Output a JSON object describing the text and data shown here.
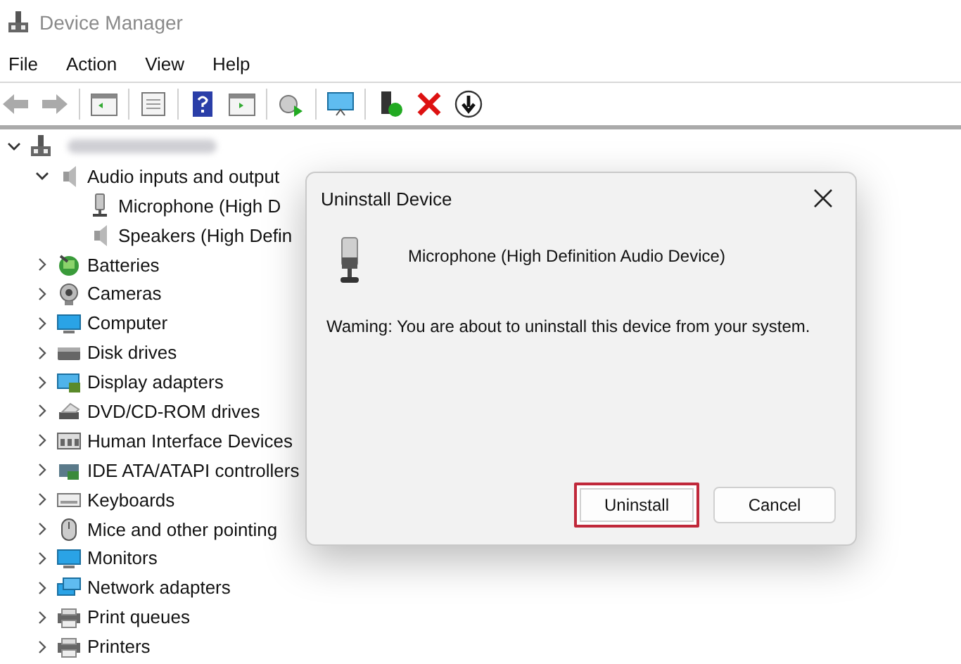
{
  "window": {
    "title": "Device Manager"
  },
  "menu": [
    "File",
    "Action",
    "View",
    "Help"
  ],
  "tree": {
    "expanded": true,
    "children": [
      {
        "label": "Audio inputs and output",
        "kind": "speaker",
        "expanded": true,
        "children": [
          {
            "label": "Microphone (High D",
            "kind": "microphone"
          },
          {
            "label": "Speakers (High Defin",
            "kind": "speaker"
          }
        ]
      },
      {
        "label": "Batteries",
        "kind": "battery",
        "expanded": false
      },
      {
        "label": "Cameras",
        "kind": "camera",
        "expanded": false
      },
      {
        "label": "Computer",
        "kind": "computer",
        "expanded": false
      },
      {
        "label": "Disk drives",
        "kind": "disk",
        "expanded": false
      },
      {
        "label": "Display adapters",
        "kind": "display",
        "expanded": false
      },
      {
        "label": "DVD/CD-ROM drives",
        "kind": "dvd",
        "expanded": false
      },
      {
        "label": "Human Interface Devices",
        "kind": "hid",
        "expanded": false
      },
      {
        "label": "IDE ATA/ATAPI controllers",
        "kind": "ide",
        "expanded": false
      },
      {
        "label": "Keyboards",
        "kind": "keyboard",
        "expanded": false
      },
      {
        "label": "Mice and other pointing",
        "kind": "mouse",
        "expanded": false
      },
      {
        "label": "Monitors",
        "kind": "computer",
        "expanded": false
      },
      {
        "label": "Network adapters",
        "kind": "network",
        "expanded": false
      },
      {
        "label": "Print queues",
        "kind": "printer",
        "expanded": false
      },
      {
        "label": "Printers",
        "kind": "printer",
        "expanded": false
      }
    ]
  },
  "dialog": {
    "title": "Uninstall Device",
    "device": "Microphone (High Definition Audio Device)",
    "warning": "Waming: You are about to uninstall this device from your system.",
    "buttons": [
      {
        "label": "Uninstall",
        "focused": true
      },
      {
        "label": "Cancel",
        "focused": false
      }
    ]
  }
}
